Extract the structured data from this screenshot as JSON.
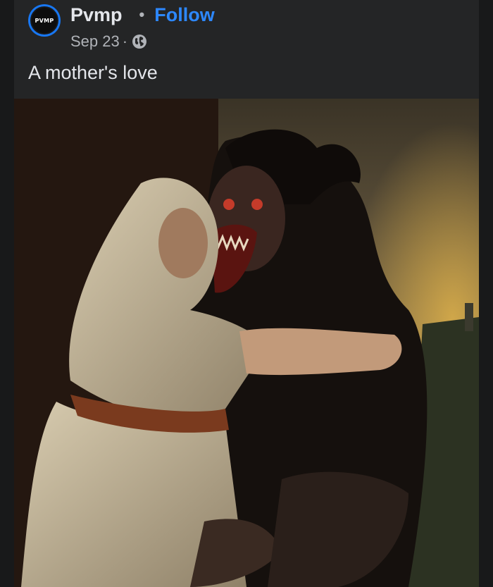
{
  "post": {
    "author": "Pvmp",
    "avatar_text": "PVMP",
    "separator": "•",
    "follow_label": "Follow",
    "date": "Sep 23",
    "meta_separator": "·",
    "audience_icon": "globe-icon",
    "caption": "A mother's love",
    "image_description_icon": "painting",
    "colors": {
      "background": "#18191a",
      "card": "#242526",
      "accent": "#2d88ff",
      "secondary_text": "#b0b3b8"
    }
  }
}
